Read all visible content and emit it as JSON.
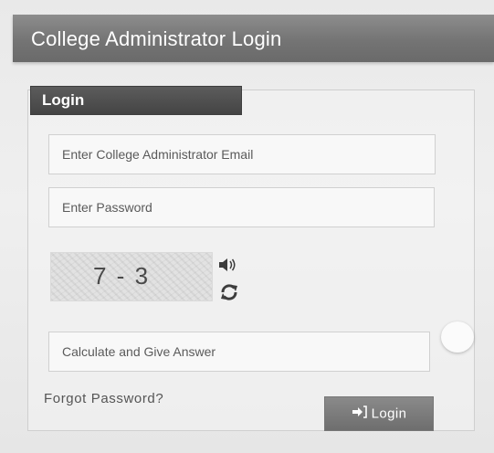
{
  "header": {
    "title": "College Administrator Login"
  },
  "panel": {
    "tab_label": "Login"
  },
  "form": {
    "email_placeholder": "Enter College Administrator Email",
    "email_value": "",
    "password_placeholder": "Enter Password",
    "password_value": "",
    "captcha_text": "7 - 3",
    "answer_placeholder": "Calculate and Give Answer",
    "answer_value": ""
  },
  "actions": {
    "forgot_password": "Forgot Password?",
    "login_label": "Login"
  },
  "icons": {
    "audio": "speaker-icon",
    "refresh": "refresh-icon",
    "login": "sign-in-icon"
  },
  "colors": {
    "header_bg": "#7a7a7a",
    "tab_bg": "#4a4a4a",
    "button_bg": "#7c7c7c",
    "text_white": "#ffffff"
  }
}
